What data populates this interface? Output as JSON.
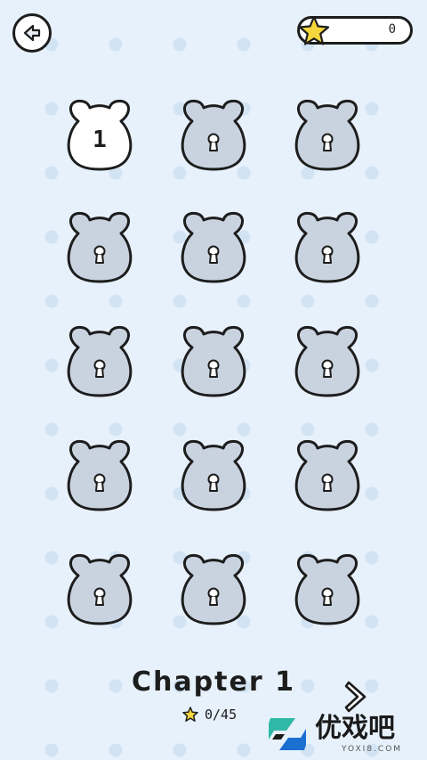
{
  "header": {
    "back_icon": "back-arrow-icon",
    "star_icon": "star-icon",
    "star_count": "0"
  },
  "levels": [
    {
      "label": "1",
      "state": "unlocked"
    },
    {
      "label": "",
      "state": "locked"
    },
    {
      "label": "",
      "state": "locked"
    },
    {
      "label": "",
      "state": "locked"
    },
    {
      "label": "",
      "state": "locked"
    },
    {
      "label": "",
      "state": "locked"
    },
    {
      "label": "",
      "state": "locked"
    },
    {
      "label": "",
      "state": "locked"
    },
    {
      "label": "",
      "state": "locked"
    },
    {
      "label": "",
      "state": "locked"
    },
    {
      "label": "",
      "state": "locked"
    },
    {
      "label": "",
      "state": "locked"
    },
    {
      "label": "",
      "state": "locked"
    },
    {
      "label": "",
      "state": "locked"
    },
    {
      "label": "",
      "state": "locked"
    }
  ],
  "footer": {
    "chapter_title": "Chapter 1",
    "progress": "0/45",
    "next_icon": "chevron-right-icon"
  },
  "watermark": {
    "text": "优戏吧",
    "subtext": "YOXI8.COM"
  },
  "colors": {
    "background": "#e7f1fb",
    "locked_fill": "#c9d3e0",
    "unlocked_fill": "#ffffff",
    "star": "#f5d63c",
    "outline": "#1d1d1d"
  }
}
